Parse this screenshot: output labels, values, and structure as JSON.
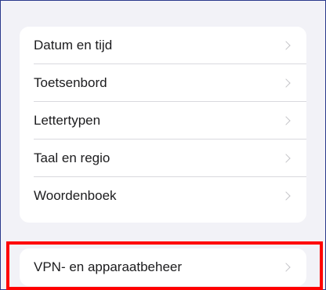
{
  "settings_group": {
    "items": [
      {
        "label": "Datum en tijd"
      },
      {
        "label": "Toetsenbord"
      },
      {
        "label": "Lettertypen"
      },
      {
        "label": "Taal en regio"
      },
      {
        "label": "Woordenboek"
      }
    ]
  },
  "vpn_group": {
    "label": "VPN- en apparaatbeheer"
  },
  "colors": {
    "background": "#f2f2f7",
    "card": "#ffffff",
    "text": "#1c1c1e",
    "chevron": "#c4c4c8",
    "highlight": "#ff0000"
  },
  "icons": [
    "chevron-right-icon"
  ]
}
